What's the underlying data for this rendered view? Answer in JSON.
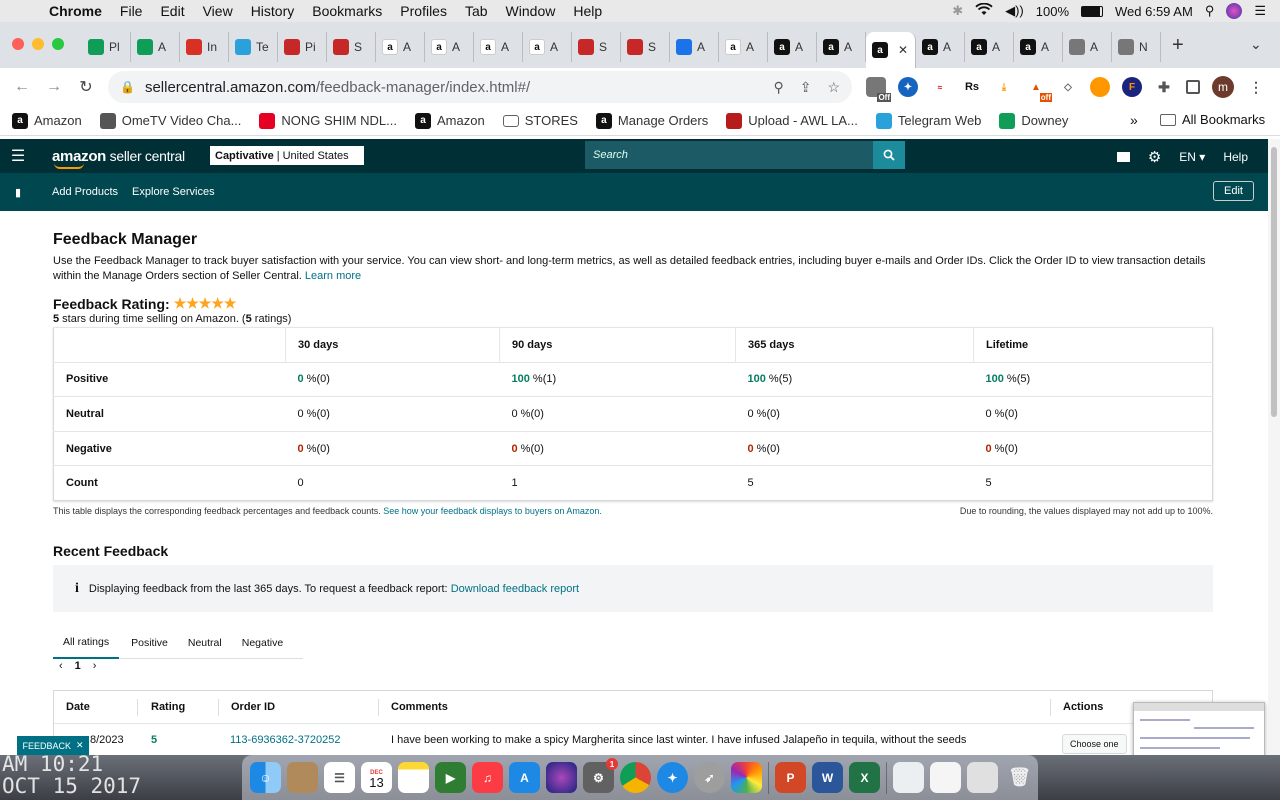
{
  "menubar": {
    "app": "Chrome",
    "items": [
      "File",
      "Edit",
      "View",
      "History",
      "Bookmarks",
      "Profiles",
      "Tab",
      "Window",
      "Help"
    ],
    "battery": "100%",
    "datetime": "Wed 6:59 AM"
  },
  "tabs": [
    {
      "label": "Pl",
      "icon": "sheets-icon",
      "color": "#0f9d58"
    },
    {
      "label": "A",
      "icon": "sheets-icon",
      "color": "#0f9d58"
    },
    {
      "label": "In",
      "icon": "gmail-icon",
      "color": "#d93025"
    },
    {
      "label": "Te",
      "icon": "telegram-icon",
      "color": "#2aa1da"
    },
    {
      "label": "Pi",
      "icon": "pinwheel-icon",
      "color": "#c62828"
    },
    {
      "label": "S",
      "icon": "pinwheel-icon",
      "color": "#c62828"
    },
    {
      "label": "A",
      "icon": "amazon-icon",
      "color": "#ffffff"
    },
    {
      "label": "A",
      "icon": "amazon-icon",
      "color": "#ffffff"
    },
    {
      "label": "A",
      "icon": "amazon-icon",
      "color": "#ffffff"
    },
    {
      "label": "A",
      "icon": "amazon-icon",
      "color": "#ffffff"
    },
    {
      "label": "S",
      "icon": "pinwheel-icon",
      "color": "#c62828"
    },
    {
      "label": "S",
      "icon": "pinwheel-icon",
      "color": "#c62828"
    },
    {
      "label": "A",
      "icon": "pen-icon",
      "color": "#1a73e8"
    },
    {
      "label": "A",
      "icon": "amazon-icon",
      "color": "#ffffff"
    },
    {
      "label": "A",
      "icon": "amazon-dark-icon",
      "color": "#111111"
    },
    {
      "label": "A",
      "icon": "amazon-dark-icon",
      "color": "#111111"
    },
    {
      "label": "",
      "icon": "amazon-dark-icon",
      "color": "#111111",
      "active": true
    },
    {
      "label": "A",
      "icon": "amazon-dark-icon",
      "color": "#111111"
    },
    {
      "label": "A",
      "icon": "amazon-dark-icon",
      "color": "#111111"
    },
    {
      "label": "A",
      "icon": "amazon-dark-icon",
      "color": "#111111"
    },
    {
      "label": "A",
      "icon": "globe-icon",
      "color": "#777777"
    },
    {
      "label": "N",
      "icon": "globe-icon",
      "color": "#777777"
    }
  ],
  "url": {
    "host": "sellercentral.amazon.com",
    "path": "/feedback-manager/index.html#/"
  },
  "extensions": {
    "badge1": "Off",
    "badge2": "off",
    "rs": "Rs",
    "profile": "m"
  },
  "bookmarks": [
    {
      "label": "Amazon",
      "icon": "amazon-dark-icon",
      "color": "#111111"
    },
    {
      "label": "OmeTV Video Cha...",
      "icon": "globe-icon",
      "color": "#555555"
    },
    {
      "label": "NONG SHIM NDL...",
      "icon": "pinterest-icon",
      "color": "#e60023"
    },
    {
      "label": "Amazon",
      "icon": "amazon-dark-icon",
      "color": "#111111"
    },
    {
      "label": "STORES",
      "icon": "folder-icon",
      "color": "#5f6368"
    },
    {
      "label": "Manage Orders",
      "icon": "amazon-dark-icon",
      "color": "#111111"
    },
    {
      "label": "Upload - AWL LA...",
      "icon": "triangle-icon",
      "color": "#b71c1c"
    },
    {
      "label": "Telegram Web",
      "icon": "telegram-icon",
      "color": "#2aa1da"
    },
    {
      "label": "Downey",
      "icon": "sheets-icon",
      "color": "#0f9d58"
    }
  ],
  "bookmarks_more": "»",
  "bookmarks_all": "All Bookmarks",
  "header": {
    "logo_main": "amazon",
    "logo_sub": " seller central",
    "store_name": "Captivative",
    "store_region": "| United States",
    "search_placeholder": "Search",
    "lang": "EN",
    "help": "Help"
  },
  "subnav": {
    "items": [
      "Add Products",
      "Explore Services"
    ],
    "edit": "Edit"
  },
  "page": {
    "title": "Feedback Manager",
    "description": "Use the Feedback Manager to track buyer satisfaction with your service. You can view short- and long-term metrics, as well as detailed feedback entries, including buyer e-mails and Order IDs. Click the Order ID to view transaction details within the Manage Orders section of Seller Central.",
    "learn_more": "Learn more",
    "rating_label": "Feedback Rating:",
    "rating_stars": "★★★★★",
    "rating_value": 5,
    "rating_sub_bold": "5",
    "rating_sub_mid": " stars during time selling on Amazon. (",
    "rating_count_bold": "5",
    "rating_sub_end": " ratings)"
  },
  "metrics": {
    "columns": [
      "30 days",
      "90 days",
      "365 days",
      "Lifetime"
    ],
    "rows": [
      {
        "label": "Positive",
        "cells": [
          [
            "0",
            " %(0)"
          ],
          [
            "100",
            " %(1)"
          ],
          [
            "100",
            " %(5)"
          ],
          [
            "100",
            " %(5)"
          ]
        ]
      },
      {
        "label": "Neutral",
        "cells": [
          [
            "0",
            " %(0)"
          ],
          [
            "0",
            " %(0)"
          ],
          [
            "0",
            " %(0)"
          ],
          [
            "0",
            " %(0)"
          ]
        ]
      },
      {
        "label": "Negative",
        "cells": [
          [
            "0",
            " %(0)"
          ],
          [
            "0",
            " %(0)"
          ],
          [
            "0",
            " %(0)"
          ],
          [
            "0",
            " %(0)"
          ]
        ]
      },
      {
        "label": "Count",
        "cells": [
          [
            "",
            "0"
          ],
          [
            "",
            "1"
          ],
          [
            "",
            "5"
          ],
          [
            "",
            "5"
          ]
        ]
      }
    ],
    "note_left": "This table displays the corresponding feedback percentages and feedback counts.",
    "note_link": "See how your feedback displays to buyers on Amazon.",
    "note_right": "Due to rounding, the values displayed may not add up to 100%."
  },
  "recent": {
    "title": "Recent Feedback",
    "info_text": "Displaying feedback from the last 365 days. To request a feedback report:",
    "info_link": "Download feedback report",
    "tabs": [
      "All ratings",
      "Positive",
      "Neutral",
      "Negative"
    ],
    "page": "1",
    "columns": [
      "Date",
      "Rating",
      "Order ID",
      "Comments",
      "Actions"
    ],
    "row": {
      "date": "8/2023",
      "rating": "5",
      "order_id": "113-6936362-3720252",
      "comment": "I have been working to make a spicy Margherita since last winter. I have infused Jalapeño in tequila, without the seeds",
      "action": "Choose one"
    }
  },
  "feedback_tab": "FEEDBACK",
  "wallpaper_clock": {
    "line1": "AM 10:21",
    "line2": "OCT 15 2017"
  },
  "dock": {
    "calendar_month": "DEC",
    "calendar_day": "13",
    "badge": "1"
  }
}
